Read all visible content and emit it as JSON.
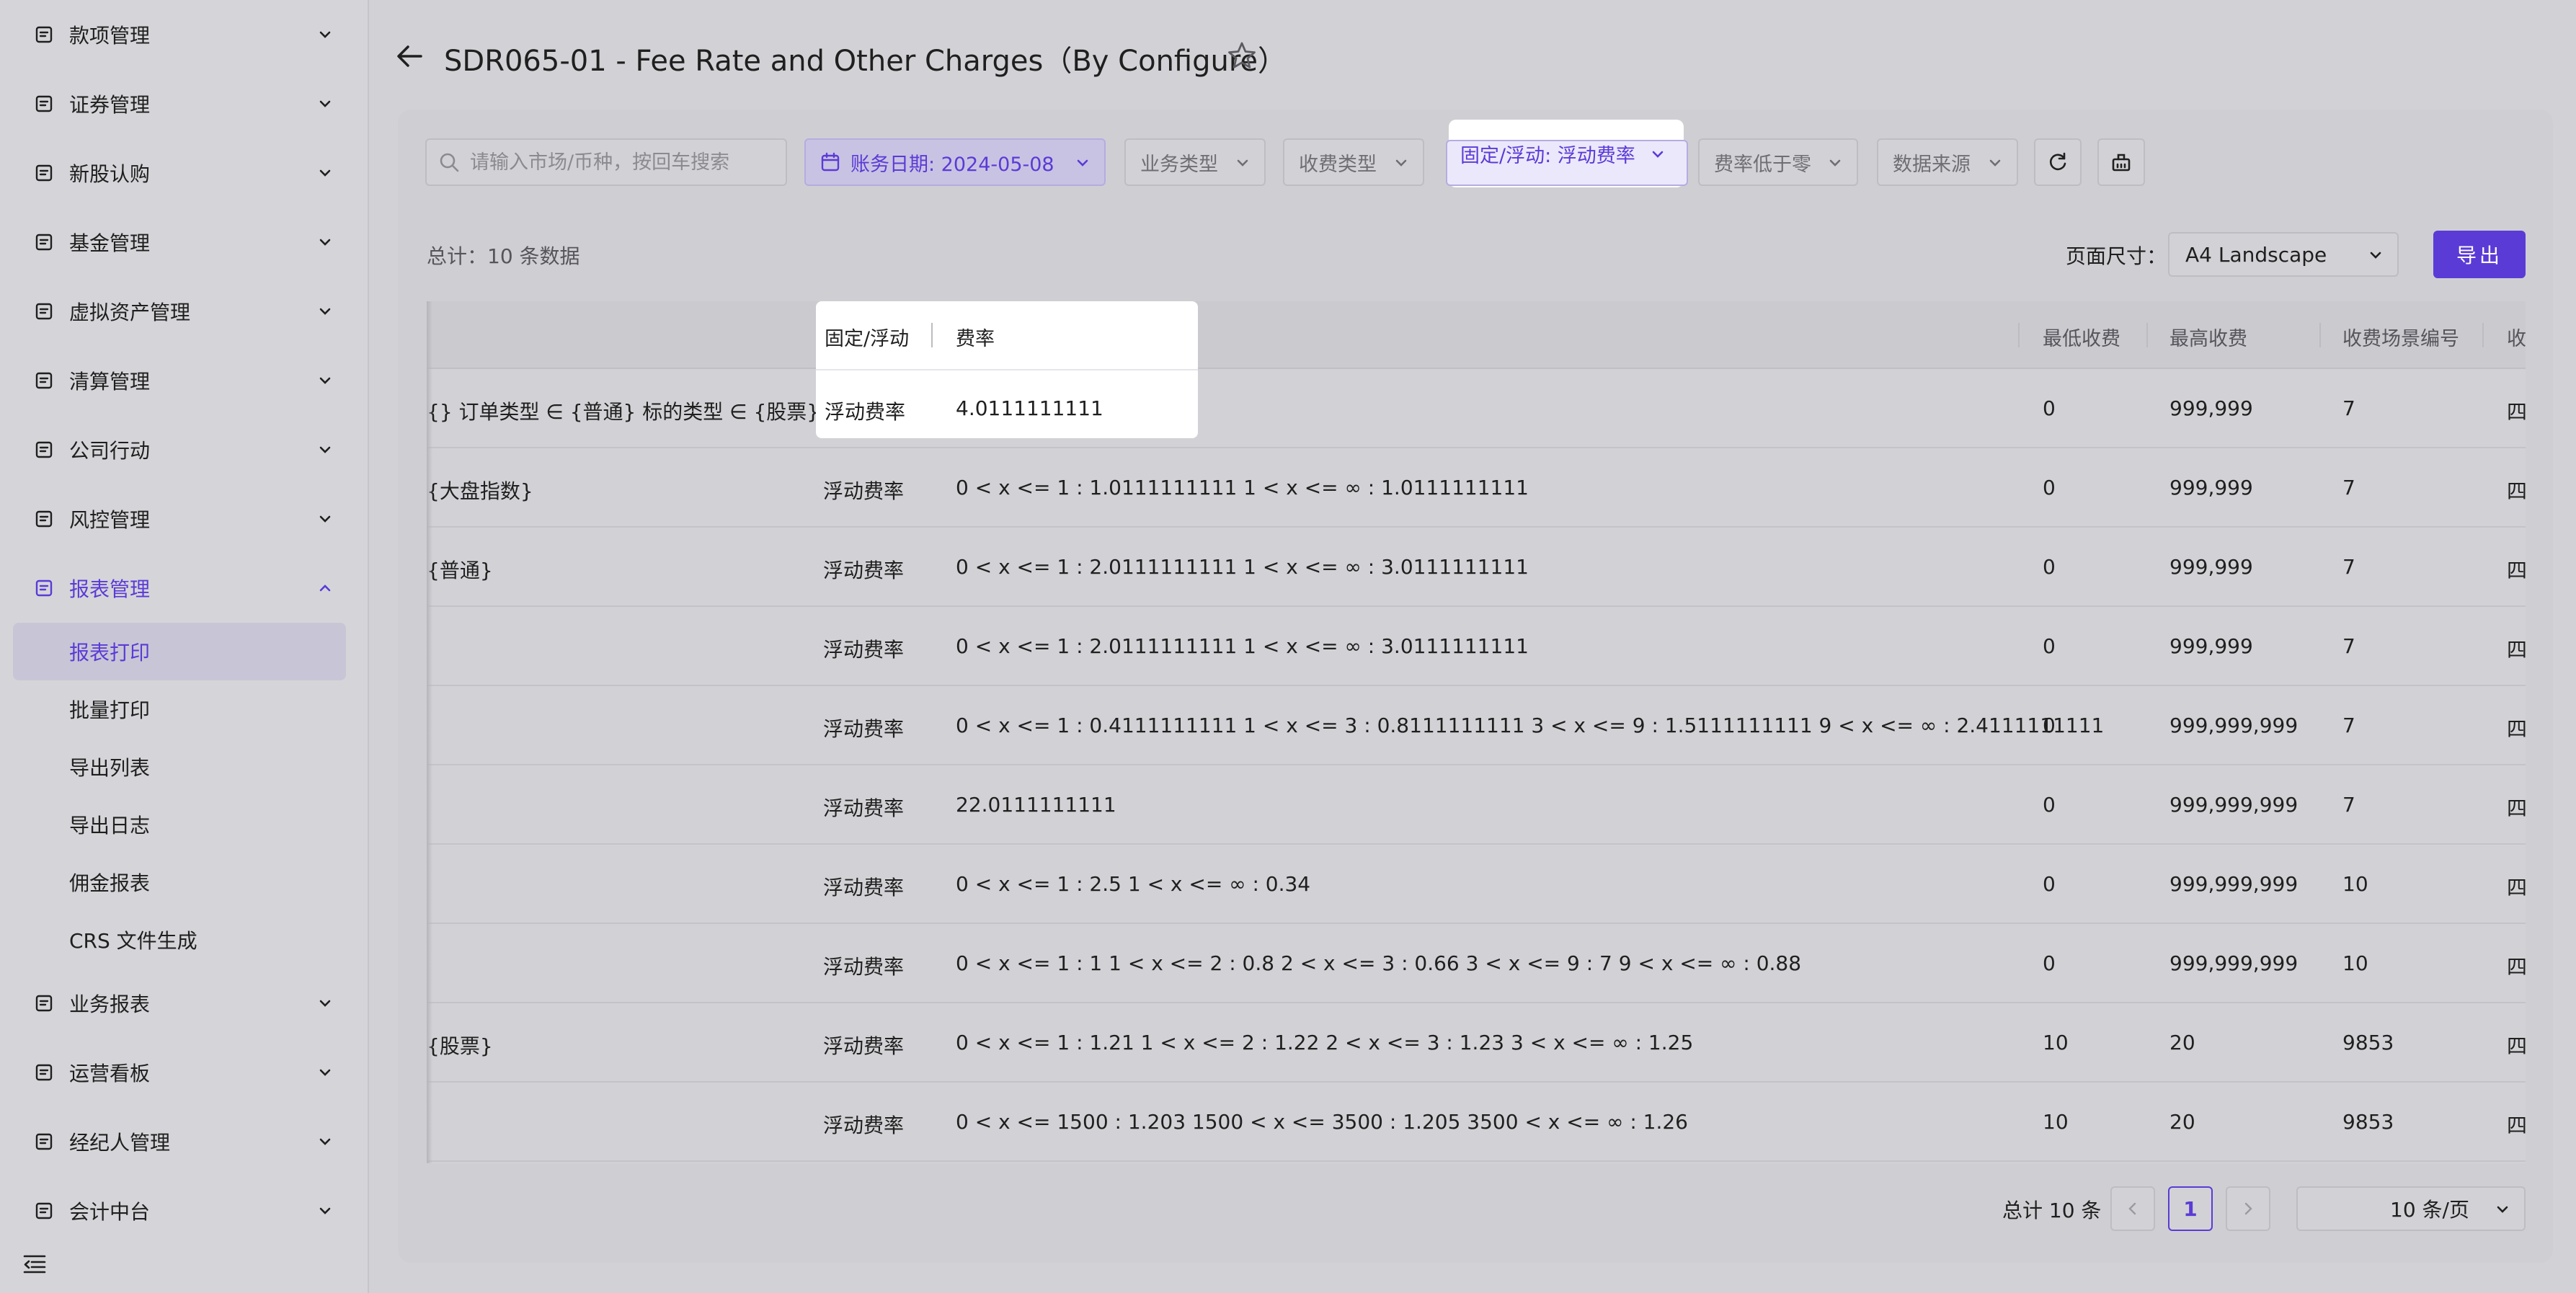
{
  "sidebar": {
    "items": [
      {
        "label": "款项管理",
        "icon": "document-list-icon"
      },
      {
        "label": "证券管理",
        "icon": "chart-box-icon"
      },
      {
        "label": "新股认购",
        "icon": "exchange-icon"
      },
      {
        "label": "基金管理",
        "icon": "fund-chart-icon"
      },
      {
        "label": "虚拟资产管理",
        "icon": "virtual-asset-icon"
      },
      {
        "label": "清算管理",
        "icon": "clearing-icon"
      },
      {
        "label": "公司行动",
        "icon": "building-icon"
      },
      {
        "label": "风控管理",
        "icon": "shield-icon"
      },
      {
        "label": "报表管理",
        "icon": "report-icon"
      }
    ],
    "sub_items": [
      "报表打印",
      "批量打印",
      "导出列表",
      "导出日志",
      "佣金报表",
      "CRS 文件生成"
    ],
    "lower_items": [
      {
        "label": "业务报表",
        "icon": "line-chart-icon"
      },
      {
        "label": "运营看板",
        "icon": "dashboard-chart-icon"
      },
      {
        "label": "经纪人管理",
        "icon": "users-icon"
      },
      {
        "label": "会计中台",
        "icon": "accounting-icon"
      }
    ]
  },
  "header": {
    "title": "SDR065-01 - Fee Rate and Other Charges（By Configure）"
  },
  "filters": {
    "search_placeholder": "请输入市场/币种，按回车搜索",
    "date": "账务日期: 2024-05-08",
    "business_type": "业务类型",
    "charge_type": "收费类型",
    "fixed_floating": "固定/浮动: 浮动费率",
    "rate_below_zero": "费率低于零",
    "data_source": "数据来源"
  },
  "summary": {
    "total": "总计：10 条数据",
    "page_size_label": "页面尺寸：",
    "page_size_value": "A4 Landscape",
    "export": "导出"
  },
  "table": {
    "headers": [
      "固定/浮动",
      "费率",
      "最低收费",
      "最高收费",
      "收费场景编号",
      "收"
    ],
    "rows": [
      {
        "cond": "{} 订单类型 ∈ {普通} 标的类型 ∈ {股票}",
        "type": "浮动费率",
        "rate": "4.0111111111",
        "min": "0",
        "max": "999,999",
        "scene": "7",
        "tail": "四"
      },
      {
        "cond": "{大盘指数}",
        "type": "浮动费率",
        "rate": "0 < x <= 1 : 1.0111111111 1 < x <= ∞ : 1.0111111111",
        "min": "0",
        "max": "999,999",
        "scene": "7",
        "tail": "四"
      },
      {
        "cond": "{普通}",
        "type": "浮动费率",
        "rate": "0 < x <= 1 : 2.0111111111 1 < x <= ∞ : 3.0111111111",
        "min": "0",
        "max": "999,999",
        "scene": "7",
        "tail": "四"
      },
      {
        "cond": "",
        "type": "浮动费率",
        "rate": "0 < x <= 1 : 2.0111111111 1 < x <= ∞ : 3.0111111111",
        "min": "0",
        "max": "999,999",
        "scene": "7",
        "tail": "四"
      },
      {
        "cond": "",
        "type": "浮动费率",
        "rate": "0 < x <= 1 : 0.4111111111 1 < x <= 3 : 0.8111111111 3 < x <= 9 : 1.5111111111 9 < x <= ∞ : 2.4111111111",
        "min": "0",
        "max": "999,999,999",
        "scene": "7",
        "tail": "四"
      },
      {
        "cond": "",
        "type": "浮动费率",
        "rate": "22.0111111111",
        "min": "0",
        "max": "999,999,999",
        "scene": "7",
        "tail": "四"
      },
      {
        "cond": "",
        "type": "浮动费率",
        "rate": "0 < x <= 1 : 2.5 1 < x <= ∞ : 0.34",
        "min": "0",
        "max": "999,999,999",
        "scene": "10",
        "tail": "四"
      },
      {
        "cond": "",
        "type": "浮动费率",
        "rate": "0 < x <= 1 : 1 1 < x <= 2 : 0.8 2 < x <= 3 : 0.66 3 < x <= 9 : 7 9 < x <= ∞ : 0.88",
        "min": "0",
        "max": "999,999,999",
        "scene": "10",
        "tail": "四"
      },
      {
        "cond": "{股票}",
        "type": "浮动费率",
        "rate": "0 < x <= 1 : 1.21 1 < x <= 2 : 1.22 2 < x <= 3 : 1.23 3 < x <= ∞ : 1.25",
        "min": "10",
        "max": "20",
        "scene": "9853",
        "tail": "四"
      },
      {
        "cond": "",
        "type": "浮动费率",
        "rate": "0 < x <= 1500 : 1.203 1500 < x <= 3500 : 1.205 3500 < x <= ∞ : 1.26",
        "min": "10",
        "max": "20",
        "scene": "9853",
        "tail": "四"
      }
    ]
  },
  "pagination": {
    "total": "总计 10 条",
    "current_page": "1",
    "page_size": "10 条/页"
  },
  "colors": {
    "accent": "#5b3bd6"
  }
}
